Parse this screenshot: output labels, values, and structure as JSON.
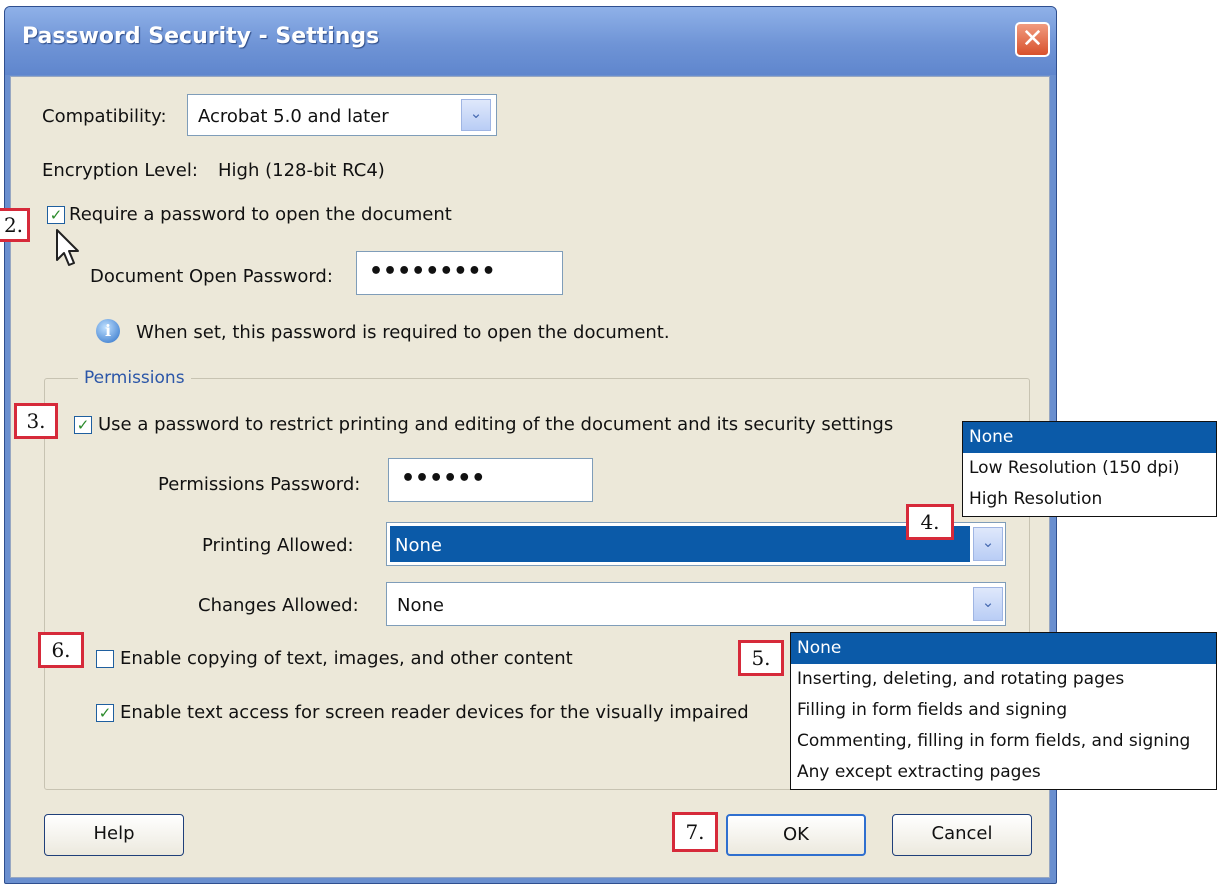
{
  "window": {
    "title": "Password Security - Settings",
    "close_glyph": "✕"
  },
  "compatibility": {
    "label": "Compatibility:",
    "value": "Acrobat 5.0 and later"
  },
  "encryption": {
    "label": "Encryption  Level:",
    "value": "High (128-bit RC4)"
  },
  "open_password": {
    "checkbox_label": "Require a password to open the document",
    "checked": true,
    "field_label": "Document Open Password:",
    "field_value": "•••••••••",
    "info_text": "When set, this password is required to open the document."
  },
  "permissions": {
    "legend": "Permissions",
    "restrict_label": "Use a password to restrict printing and editing of the document and its security settings",
    "restrict_checked": true,
    "password_label": "Permissions Password:",
    "password_value": "••••••",
    "printing_label": "Printing Allowed:",
    "printing_value": "None",
    "printing_options": [
      "None",
      "Low Resolution (150 dpi)",
      "High Resolution"
    ],
    "changes_label": "Changes Allowed:",
    "changes_value": "None",
    "changes_options": [
      "None",
      "Inserting, deleting, and rotating pages",
      "Filling in form fields and signing",
      "Commenting, filling in form fields, and signing",
      "Any except extracting pages"
    ],
    "copy_label": "Enable copying of text, images, and other content",
    "copy_checked": false,
    "access_label": "Enable text access for screen reader devices for the visually impaired",
    "access_checked": true
  },
  "buttons": {
    "help": "Help",
    "ok": "OK",
    "cancel": "Cancel"
  },
  "callouts": {
    "step2": "2.",
    "step3": "3.",
    "step4": "4.",
    "step5": "5.",
    "step6": "6.",
    "step7": "7."
  },
  "glyphs": {
    "check": "✓",
    "chevron": "⌄",
    "info": "i"
  },
  "colors": {
    "titlebar": "#6f94d6",
    "dialog_bg": "#ece8d9",
    "selection": "#0b5aa8",
    "callout_border": "#d62a3a",
    "legend_text": "#2b56a8"
  }
}
